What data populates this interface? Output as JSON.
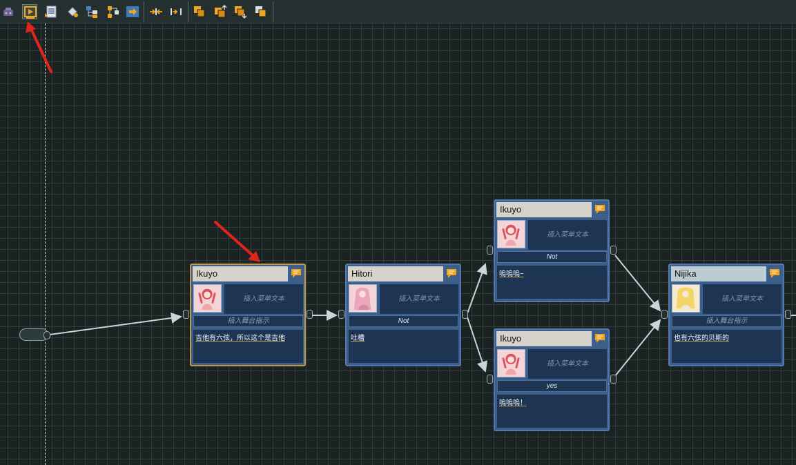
{
  "toolbar": {
    "buttons": [
      {
        "icon": "component-icon",
        "active": false
      },
      {
        "icon": "play-icon",
        "active": true
      },
      {
        "icon": "list-document-icon",
        "active": false
      },
      {
        "icon": "fill-bucket-icon",
        "active": false
      },
      {
        "icon": "hierarchy-icon",
        "active": false
      },
      {
        "icon": "branch-icon",
        "active": false
      },
      {
        "icon": "export-arrow-icon",
        "active": false
      },
      {
        "icon": "collapse-in-icon",
        "active": false
      },
      {
        "icon": "collapse-out-icon",
        "active": false
      },
      {
        "icon": "layer-icon",
        "active": false
      },
      {
        "icon": "layer-up-icon",
        "active": false
      },
      {
        "icon": "layer-down-icon",
        "active": false
      },
      {
        "icon": "layer-stack-icon",
        "active": false
      }
    ]
  },
  "nodes": {
    "n1": {
      "speaker": "Ikuyo",
      "menu_text": "插入菜单文本",
      "condition": "插入舞台指示",
      "dialogue": "吉他有六弦，所以这个是吉他"
    },
    "n2": {
      "speaker": "Hitori",
      "menu_text": "插入菜单文本",
      "condition": "Not",
      "dialogue": "吐槽"
    },
    "n3": {
      "speaker": "Ikuyo",
      "menu_text": "插入菜单文本",
      "condition": "Not",
      "dialogue": "嗚嗚嗚~"
    },
    "n4": {
      "speaker": "Ikuyo",
      "menu_text": "插入菜单文本",
      "condition": "yes",
      "dialogue": "嗚嗚嗚！"
    },
    "n5": {
      "speaker": "Nijika",
      "menu_text": "插入菜单文本",
      "condition": "插入舞台指示",
      "dialogue": "也有六弦的贝斯的"
    }
  },
  "colors": {
    "node_fill": "#3d5f8c",
    "node_border": "#5278ad",
    "selected_border": "#c39a47",
    "link": "#c8d6d6",
    "annotation_arrow": "#e0261c",
    "canvas": "#1a2222"
  }
}
